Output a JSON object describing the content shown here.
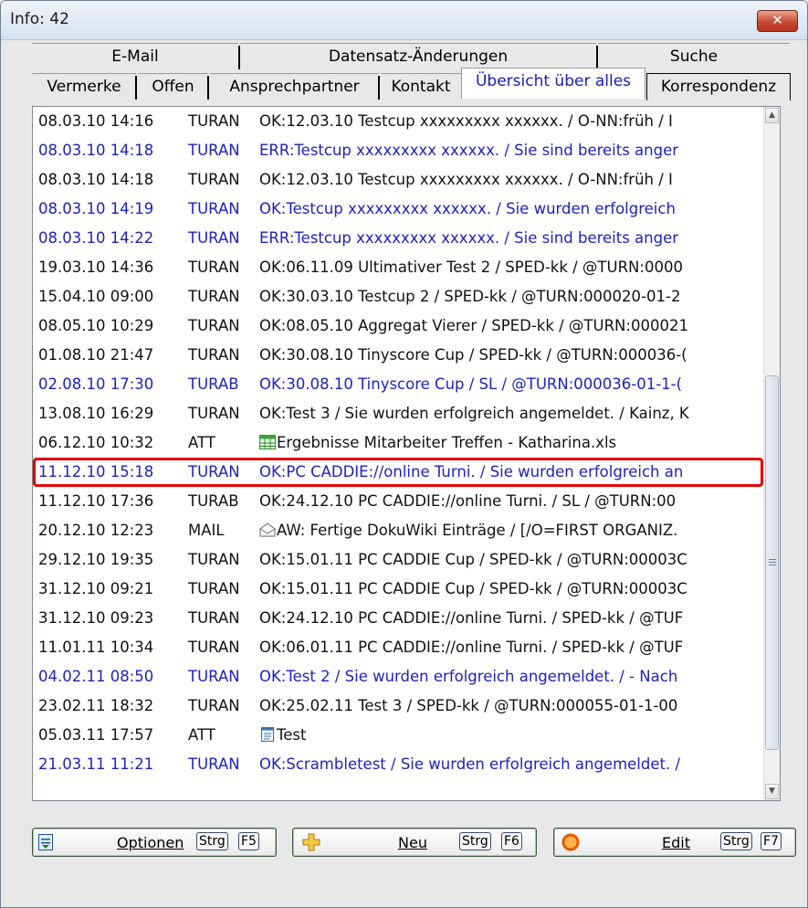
{
  "window": {
    "title": "Info: 42",
    "close_glyph": "✕"
  },
  "tabs": {
    "back": [
      {
        "label": "E-Mail"
      },
      {
        "label": "Datensatz-Änderungen"
      },
      {
        "label": "Suche"
      }
    ],
    "front": [
      {
        "label": "Vermerke"
      },
      {
        "label": "Offen"
      },
      {
        "label": "Ansprechpartner"
      },
      {
        "label": "Kontakt"
      },
      {
        "label": "Übersicht über alles"
      },
      {
        "label": "Korrespondenz"
      }
    ],
    "active": "Übersicht über alles"
  },
  "rows": [
    {
      "date": "08.03.10 14:16",
      "user": "TURAN",
      "text": "OK:12.03.10 Testcup xxxxxxxxx xxxxxx. / O-NN:früh / I",
      "color": "black"
    },
    {
      "date": "08.03.10 14:18",
      "user": "TURAN",
      "text": "ERR:Testcup xxxxxxxxx xxxxxx. / Sie sind bereits anger",
      "color": "blue"
    },
    {
      "date": "08.03.10 14:18",
      "user": "TURAN",
      "text": "OK:12.03.10 Testcup xxxxxxxxx xxxxxx. / O-NN:früh / I",
      "color": "black"
    },
    {
      "date": "08.03.10 14:19",
      "user": "TURAN",
      "text": "OK:Testcup xxxxxxxxx xxxxxx. / Sie wurden erfolgreich",
      "color": "blue"
    },
    {
      "date": "08.03.10 14:22",
      "user": "TURAN",
      "text": "ERR:Testcup xxxxxxxxx xxxxxx. / Sie sind bereits anger",
      "color": "blue"
    },
    {
      "date": "19.03.10 14:36",
      "user": "TURAN",
      "text": "OK:06.11.09 Ultimativer Test 2 / SPED-kk / @TURN:0000",
      "color": "black"
    },
    {
      "date": "15.04.10 09:00",
      "user": "TURAN",
      "text": "OK:30.03.10 Testcup 2 / SPED-kk / @TURN:000020-01-2",
      "color": "black"
    },
    {
      "date": "08.05.10 10:29",
      "user": "TURAN",
      "text": "OK:08.05.10 Aggregat Vierer / SPED-kk / @TURN:000021",
      "color": "black"
    },
    {
      "date": "01.08.10 21:47",
      "user": "TURAN",
      "text": "OK:30.08.10 Tinyscore Cup / SPED-kk / @TURN:000036-(",
      "color": "black"
    },
    {
      "date": "02.08.10 17:30",
      "user": "TURAB",
      "text": "OK:30.08.10 Tinyscore Cup / SL / @TURN:000036-01-1-(",
      "color": "blue"
    },
    {
      "date": "13.08.10 16:29",
      "user": "TURAN",
      "text": "OK:Test 3 / Sie wurden erfolgreich angemeldet. / Kainz, K",
      "color": "black"
    },
    {
      "date": "06.12.10 10:32",
      "user": "ATT",
      "text": "Ergebnisse Mitarbeiter Treffen - Katharina.xls",
      "color": "black",
      "icon": "spreadsheet-icon"
    },
    {
      "date": "11.12.10 15:18",
      "user": "TURAN",
      "text": "OK:PC CADDIE://online Turni. / Sie wurden erfolgreich an",
      "color": "blue",
      "highlight": true
    },
    {
      "date": "11.12.10 17:36",
      "user": "TURAB",
      "text": "OK:24.12.10 PC CADDIE://online Turni. / SL / @TURN:00",
      "color": "black"
    },
    {
      "date": "20.12.10 12:23",
      "user": "MAIL",
      "text": "AW: Fertige DokuWiki Einträge / [/O=FIRST ORGANIZ.",
      "color": "black",
      "icon": "envelope-icon"
    },
    {
      "date": "29.12.10 19:35",
      "user": "TURAN",
      "text": "OK:15.01.11 PC CADDIE Cup / SPED-kk / @TURN:00003C",
      "color": "black"
    },
    {
      "date": "31.12.10 09:21",
      "user": "TURAN",
      "text": "OK:15.01.11 PC CADDIE Cup / SPED-kk / @TURN:00003C",
      "color": "black"
    },
    {
      "date": "31.12.10 09:23",
      "user": "TURAN",
      "text": "OK:24.12.10 PC CADDIE://online Turni. / SPED-kk / @TUF",
      "color": "black"
    },
    {
      "date": "11.01.11 10:34",
      "user": "TURAN",
      "text": "OK:06.01.11 PC CADDIE://online Turni. / SPED-kk / @TUF",
      "color": "black"
    },
    {
      "date": "04.02.11 08:50",
      "user": "TURAN",
      "text": "OK:Test 2 / Sie wurden erfolgreich angemeldet. /  - Nach",
      "color": "blue"
    },
    {
      "date": "23.02.11 18:32",
      "user": "TURAN",
      "text": "OK:25.02.11 Test 3 / SPED-kk / @TURN:000055-01-1-00",
      "color": "black"
    },
    {
      "date": "05.03.11 17:57",
      "user": "ATT",
      "text": "Test",
      "color": "black",
      "icon": "document-icon"
    },
    {
      "date": "21.03.11 11:21",
      "user": "TURAN",
      "text": "OK:Scrambletest / Sie wurden erfolgreich angemeldet. /",
      "color": "blue"
    }
  ],
  "scrollbar": {
    "up": "▲",
    "down": "▼",
    "position_fraction": 0.6
  },
  "buttons": {
    "optionen": {
      "label": "Optionen",
      "shortcut_mod": "Strg",
      "shortcut_key": "F5"
    },
    "neu": {
      "label": "Neu",
      "shortcut_mod": "Strg",
      "shortcut_key": "F6"
    },
    "edit": {
      "label": "Edit",
      "shortcut_mod": "Strg",
      "shortcut_key": "F7"
    }
  },
  "colors": {
    "link_blue": "#1f1fc0",
    "highlight_red": "#e00000"
  }
}
